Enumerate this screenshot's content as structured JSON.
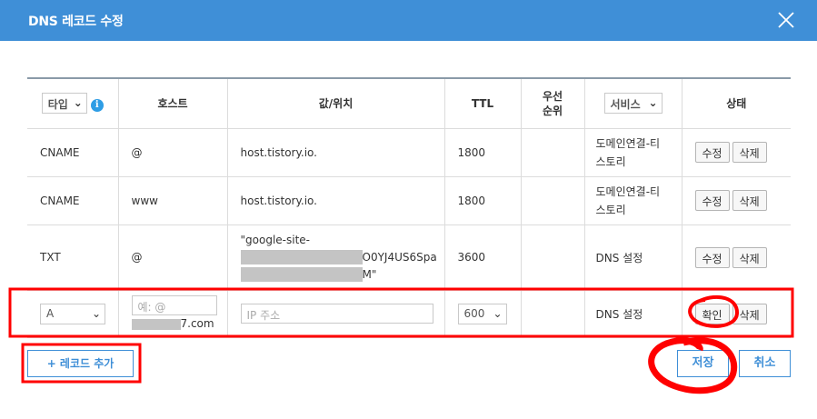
{
  "dialog": {
    "title": "DNS 레코드 수정"
  },
  "header": {
    "type_select": "타입",
    "info_icon": "i",
    "host": "호스트",
    "value": "값/위치",
    "ttl": "TTL",
    "priority": "우선\n순위",
    "service_select": "서비스",
    "status": "상태"
  },
  "rows": [
    {
      "type": "CNAME",
      "host": "@",
      "value": "host.tistory.io.",
      "ttl": "1800",
      "service": "도메인연결-티\n스토리",
      "edit": "수정",
      "delete": "삭제"
    },
    {
      "type": "CNAME",
      "host": "www",
      "value": "host.tistory.io.",
      "ttl": "1800",
      "service": "도메인연결-티\n스토리",
      "edit": "수정",
      "delete": "삭제"
    },
    {
      "type": "TXT",
      "host": "@",
      "value_line1": "\"google-site-",
      "value_line2": "O0YJ4US6Spa",
      "value_line3": "M\"",
      "ttl": "3600",
      "service": "DNS 설정",
      "edit": "수정",
      "delete": "삭제"
    }
  ],
  "new_row": {
    "type": "A",
    "host_placeholder": "예: @",
    "host_suffix": "7.com",
    "value_placeholder": "IP 주소",
    "ttl": "600",
    "service": "DNS 설정",
    "confirm": "확인",
    "delete": "삭제"
  },
  "footer": {
    "add_record": "+ 레코드 추가",
    "save": "저장",
    "cancel": "취소"
  },
  "colors": {
    "titlebar": "#3f8fd7",
    "accent": "#3f8fd7",
    "annotation": "#ff0000"
  }
}
